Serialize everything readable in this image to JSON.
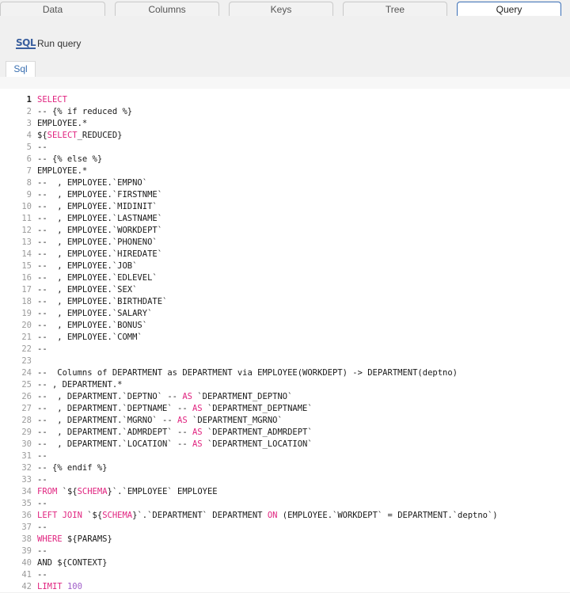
{
  "tabs": [
    {
      "label": "Data",
      "active": false
    },
    {
      "label": "Columns",
      "active": false
    },
    {
      "label": "Keys",
      "active": false
    },
    {
      "label": "Tree",
      "active": false
    },
    {
      "label": "Query",
      "active": true
    }
  ],
  "toolbar": {
    "run_icon_text": "SQL",
    "run_label": "Run query"
  },
  "subtab": {
    "label": "Sql"
  },
  "editor": {
    "current_line": 1,
    "keyword_color": "#e0237f",
    "number_color": "#a05fc9",
    "lines": [
      [
        {
          "t": "SELECT",
          "k": "kw"
        }
      ],
      [
        {
          "t": "-- {% if reduced %}"
        }
      ],
      [
        {
          "t": "EMPLOYEE.*"
        }
      ],
      [
        {
          "t": "${"
        },
        {
          "t": "SELECT",
          "k": "kw"
        },
        {
          "t": "_REDUCED}"
        }
      ],
      [
        {
          "t": "--"
        }
      ],
      [
        {
          "t": "-- {% else %}"
        }
      ],
      [
        {
          "t": "EMPLOYEE.*"
        }
      ],
      [
        {
          "t": "--  , EMPLOYEE.`EMPNO`"
        }
      ],
      [
        {
          "t": "--  , EMPLOYEE.`FIRSTNME`"
        }
      ],
      [
        {
          "t": "--  , EMPLOYEE.`MIDINIT`"
        }
      ],
      [
        {
          "t": "--  , EMPLOYEE.`LASTNAME`"
        }
      ],
      [
        {
          "t": "--  , EMPLOYEE.`WORKDEPT`"
        }
      ],
      [
        {
          "t": "--  , EMPLOYEE.`PHONENO`"
        }
      ],
      [
        {
          "t": "--  , EMPLOYEE.`HIREDATE`"
        }
      ],
      [
        {
          "t": "--  , EMPLOYEE.`JOB`"
        }
      ],
      [
        {
          "t": "--  , EMPLOYEE.`EDLEVEL`"
        }
      ],
      [
        {
          "t": "--  , EMPLOYEE.`SEX`"
        }
      ],
      [
        {
          "t": "--  , EMPLOYEE.`BIRTHDATE`"
        }
      ],
      [
        {
          "t": "--  , EMPLOYEE.`SALARY`"
        }
      ],
      [
        {
          "t": "--  , EMPLOYEE.`BONUS`"
        }
      ],
      [
        {
          "t": "--  , EMPLOYEE.`COMM`"
        }
      ],
      [
        {
          "t": "--"
        }
      ],
      [
        {
          "t": ""
        }
      ],
      [
        {
          "t": "--  Columns of DEPARTMENT as DEPARTMENT via EMPLOYEE(WORKDEPT) -> DEPARTMENT(deptno)"
        }
      ],
      [
        {
          "t": "-- , DEPARTMENT.*"
        }
      ],
      [
        {
          "t": "--  , DEPARTMENT.`DEPTNO` -- "
        },
        {
          "t": "AS",
          "k": "kw"
        },
        {
          "t": " `DEPARTMENT_DEPTNO`"
        }
      ],
      [
        {
          "t": "--  , DEPARTMENT.`DEPTNAME` -- "
        },
        {
          "t": "AS",
          "k": "kw"
        },
        {
          "t": " `DEPARTMENT_DEPTNAME`"
        }
      ],
      [
        {
          "t": "--  , DEPARTMENT.`MGRNO` -- "
        },
        {
          "t": "AS",
          "k": "kw"
        },
        {
          "t": " `DEPARTMENT_MGRNO`"
        }
      ],
      [
        {
          "t": "--  , DEPARTMENT.`ADMRDEPT` -- "
        },
        {
          "t": "AS",
          "k": "kw"
        },
        {
          "t": " `DEPARTMENT_ADMRDEPT`"
        }
      ],
      [
        {
          "t": "--  , DEPARTMENT.`LOCATION` -- "
        },
        {
          "t": "AS",
          "k": "kw"
        },
        {
          "t": " `DEPARTMENT_LOCATION`"
        }
      ],
      [
        {
          "t": "--"
        }
      ],
      [
        {
          "t": "-- {% endif %}"
        }
      ],
      [
        {
          "t": "--"
        }
      ],
      [
        {
          "t": "FROM",
          "k": "kw"
        },
        {
          "t": " `${"
        },
        {
          "t": "SCHEMA",
          "k": "kw"
        },
        {
          "t": "}`.`EMPLOYEE` EMPLOYEE"
        }
      ],
      [
        {
          "t": "--"
        }
      ],
      [
        {
          "t": "LEFT JOIN",
          "k": "kw"
        },
        {
          "t": " `${"
        },
        {
          "t": "SCHEMA",
          "k": "kw"
        },
        {
          "t": "}`.`DEPARTMENT` DEPARTMENT "
        },
        {
          "t": "ON",
          "k": "kw"
        },
        {
          "t": " (EMPLOYEE.`WORKDEPT` = DEPARTMENT.`deptno`)"
        }
      ],
      [
        {
          "t": "--"
        }
      ],
      [
        {
          "t": "WHERE",
          "k": "kw"
        },
        {
          "t": " ${PARAMS}"
        }
      ],
      [
        {
          "t": "--"
        }
      ],
      [
        {
          "t": "AND ${CONTEXT}"
        }
      ],
      [
        {
          "t": "--"
        }
      ],
      [
        {
          "t": "LIMIT",
          "k": "kw"
        },
        {
          "t": " "
        },
        {
          "t": "100",
          "k": "num"
        }
      ]
    ]
  }
}
